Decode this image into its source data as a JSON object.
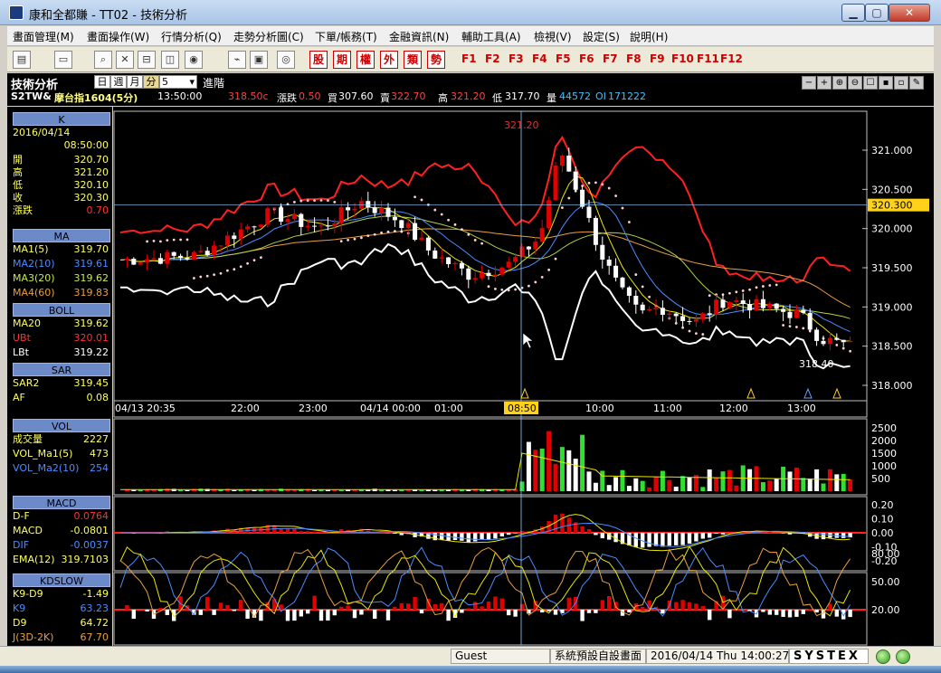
{
  "window": {
    "title": "康和全都賺 - TT02 - 技術分析",
    "min": "▁",
    "max": "▢",
    "close": "✕"
  },
  "menu": [
    "畫面管理(M)",
    "畫面操作(W)",
    "行情分析(Q)",
    "走勢分析圖(C)",
    "下單/帳務(T)",
    "金融資訊(N)",
    "輔助工具(A)",
    "檢視(V)",
    "設定(S)",
    "說明(H)"
  ],
  "toolbar": {
    "quick_buttons": [
      "股",
      "期",
      "權",
      "外",
      "類",
      "勢"
    ],
    "fkeys": [
      "F1",
      "F2",
      "F3",
      "F4",
      "F5",
      "F6",
      "F7",
      "F8",
      "F9",
      "F10",
      "F11",
      "F12"
    ]
  },
  "header": {
    "title": "技術分析",
    "periods": [
      "日",
      "週",
      "月",
      "分"
    ],
    "interval": "5",
    "advanced": "進階",
    "symbol": "S2TW&",
    "name": "摩台指1604(5分)",
    "time": "13:50:00",
    "last": "318.50c",
    "change_label": "漲跌",
    "change": "0.50",
    "bid_label": "買",
    "bid": "307.60",
    "ask_label": "賣",
    "ask": "322.70",
    "high_label": "高",
    "high": "321.20",
    "low_label": "低",
    "low": "317.70",
    "volume_label": "量",
    "volume": "44572",
    "oi_label": "OI",
    "oi": "171222"
  },
  "left_panel": {
    "k": {
      "head": "K",
      "date": "2016/04/14",
      "time": "08:50:00",
      "rows": [
        {
          "label": "開",
          "value": "320.70"
        },
        {
          "label": "高",
          "value": "321.20"
        },
        {
          "label": "低",
          "value": "320.10"
        },
        {
          "label": "收",
          "value": "320.30"
        },
        {
          "label": "漲跌",
          "value": "0.70"
        }
      ]
    },
    "ma": {
      "head": "MA",
      "rows": [
        {
          "label": "MA1(5)",
          "value": "319.70"
        },
        {
          "label": "MA2(10)",
          "value": "319.61"
        },
        {
          "label": "MA3(20)",
          "value": "319.62"
        },
        {
          "label": "MA4(60)",
          "value": "319.83"
        }
      ]
    },
    "boll": {
      "head": "BOLL",
      "rows": [
        {
          "label": "MA20",
          "value": "319.62"
        },
        {
          "label": "UBt",
          "value": "320.01"
        },
        {
          "label": "LBt",
          "value": "319.22"
        }
      ]
    },
    "sar": {
      "head": "SAR",
      "rows": [
        {
          "label": "SAR2",
          "value": "319.45"
        },
        {
          "label": "AF",
          "value": "0.08"
        }
      ]
    },
    "vol": {
      "head": "VOL",
      "rows": [
        {
          "label": "成交量",
          "value": "2227"
        },
        {
          "label": "VOL_Ma1(5)",
          "value": "473"
        },
        {
          "label": "VOL_Ma2(10)",
          "value": "254"
        }
      ]
    },
    "macd": {
      "head": "MACD",
      "rows": [
        {
          "label": "D-F",
          "value": "0.0764"
        },
        {
          "label": "MACD",
          "value": "-0.0801"
        },
        {
          "label": "DIF",
          "value": "-0.0037"
        },
        {
          "label": "EMA(12)",
          "value": "319.7103"
        }
      ]
    },
    "kd": {
      "head": "KDSLOW",
      "rows": [
        {
          "label": "K9-D9",
          "value": "-1.49"
        },
        {
          "label": "K9",
          "value": "63.23"
        },
        {
          "label": "D9",
          "value": "64.72"
        },
        {
          "label": "J(3D-2K)",
          "value": "67.70"
        }
      ]
    }
  },
  "chart": {
    "price_axis": [
      "321.000",
      "320.500",
      "320.000",
      "319.500",
      "319.000",
      "318.500",
      "318.000"
    ],
    "cursor_price": "320.300",
    "high_marker": "321.20",
    "low_marker": "318.40",
    "time_axis": [
      "04/13 20:35",
      "22:00",
      "23:00",
      "04/14 00:00",
      "01:00",
      "08:50",
      "10:00",
      "11:00",
      "12:00",
      "13:00"
    ],
    "vol_axis": [
      "2500",
      "2000",
      "1500",
      "1000",
      "500"
    ],
    "macd_axis": [
      "0.20",
      "0.10",
      "0.00",
      "-0.10",
      "-0.20"
    ],
    "kd_axis": [
      "80.00",
      "50.00",
      "20.00"
    ],
    "colors": {
      "up": "#e00000",
      "down": "#ffffff",
      "boll": "#ff2020",
      "lower_band": "#ffffff",
      "ma_yellow": "#e8e800",
      "ma_blue": "#4a8cff",
      "ma_orange": "#e8a040",
      "sar": "#ffd0d0"
    }
  },
  "status": {
    "user": "Guest",
    "layout": "系統預設自設畫面",
    "datetime": "2016/04/14 Thu 14:00:27",
    "brand": "SYSTEX"
  }
}
